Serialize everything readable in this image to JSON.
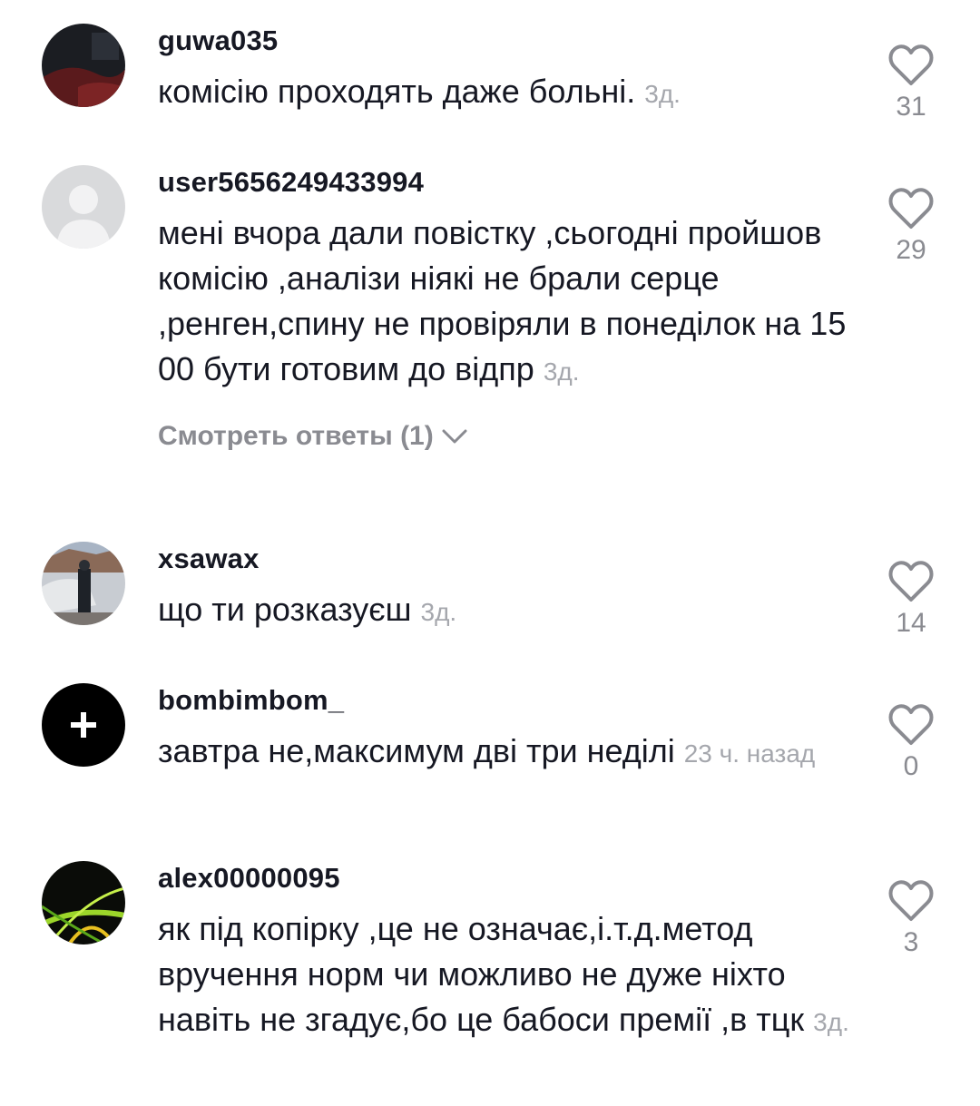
{
  "comments": [
    {
      "username": "guwa035",
      "text": "комісію проходять даже больні.",
      "time": "3д.",
      "likes": "31",
      "avatar": "avatar-dark-photo"
    },
    {
      "username": "user5656249433994",
      "text": "мені вчора дали повістку ,сьогодні пройшов комісію ,аналізи ніякі не брали серце ,ренген,спину не провіряли в понеділок на 15 00 бути готовим до відпр",
      "time": "3д.",
      "likes": "29",
      "avatar": "avatar-default-placeholder",
      "replies_label": "Смотреть ответы (1)"
    },
    {
      "username": "xsawax",
      "text": "що ти розказуєш",
      "time": "3д.",
      "likes": "14",
      "avatar": "avatar-person-car-photo"
    },
    {
      "username": "bombimbom_",
      "text": "завтра не,максимум дві три неділі",
      "time": "23 ч. назад",
      "likes": "0",
      "avatar": "avatar-black-plus"
    },
    {
      "username": "alex00000095",
      "text": "як під копірку ,це не означає,і.т.д.метод вручення норм чи можливо не дуже ніхто навіть не згадує,бо це бабоси премії ,в тцк",
      "time": "3д.",
      "likes": "3",
      "avatar": "avatar-green-swirl"
    }
  ],
  "icons": {
    "like": "heart-outline-icon",
    "expand": "chevron-down-icon"
  },
  "colors": {
    "text": "#161823",
    "muted": "#a5a7ad",
    "icon": "#8a8b91"
  }
}
